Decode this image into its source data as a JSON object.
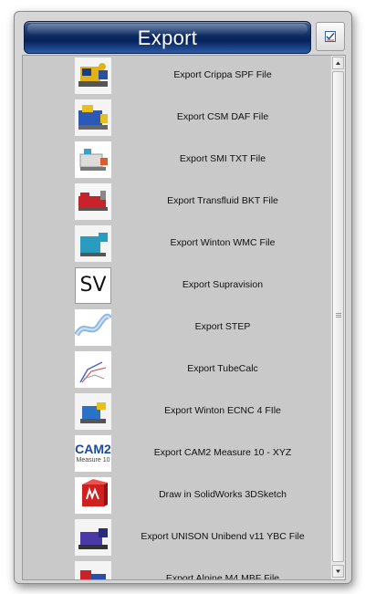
{
  "header": {
    "title": "Export"
  },
  "items": [
    {
      "label": "Export Crippa SPF File",
      "icon": "bender-machine-yellow-icon"
    },
    {
      "label": "Export CSM DAF File",
      "icon": "bender-machine-blue-icon"
    },
    {
      "label": "Export SMI TXT File",
      "icon": "bender-machine-white-icon"
    },
    {
      "label": "Export Transfluid BKT File",
      "icon": "bender-machine-red-icon"
    },
    {
      "label": "Export Winton WMC File",
      "icon": "bender-machine-teal-icon"
    },
    {
      "label": "Export Supravision",
      "icon": "supravision-logo-icon",
      "icon_text": "SV"
    },
    {
      "label": "Export STEP",
      "icon": "step-tube-icon"
    },
    {
      "label": "Export TubeCalc",
      "icon": "tubecalc-drawing-icon"
    },
    {
      "label": "Export Winton ECNC 4 FIle",
      "icon": "bender-machine-blue-small-icon"
    },
    {
      "label": "Export CAM2 Measure 10 - XYZ",
      "icon": "cam2-logo-icon",
      "icon_text": "CAM2",
      "icon_subtext": "Measure 10"
    },
    {
      "label": "Draw in SolidWorks 3DSketch",
      "icon": "solidworks-logo-icon"
    },
    {
      "label": "Export UNISON Unibend v11 YBC File",
      "icon": "bender-machine-purple-icon"
    },
    {
      "label": "Export Alpine M4 MBF File",
      "icon": "bender-machine-red-blue-icon"
    }
  ],
  "colors": {
    "header_dark": "#07225a",
    "header_light": "#2a5aa8",
    "panel": "#d6d6d6",
    "list_bg": "#c9c9c9"
  }
}
